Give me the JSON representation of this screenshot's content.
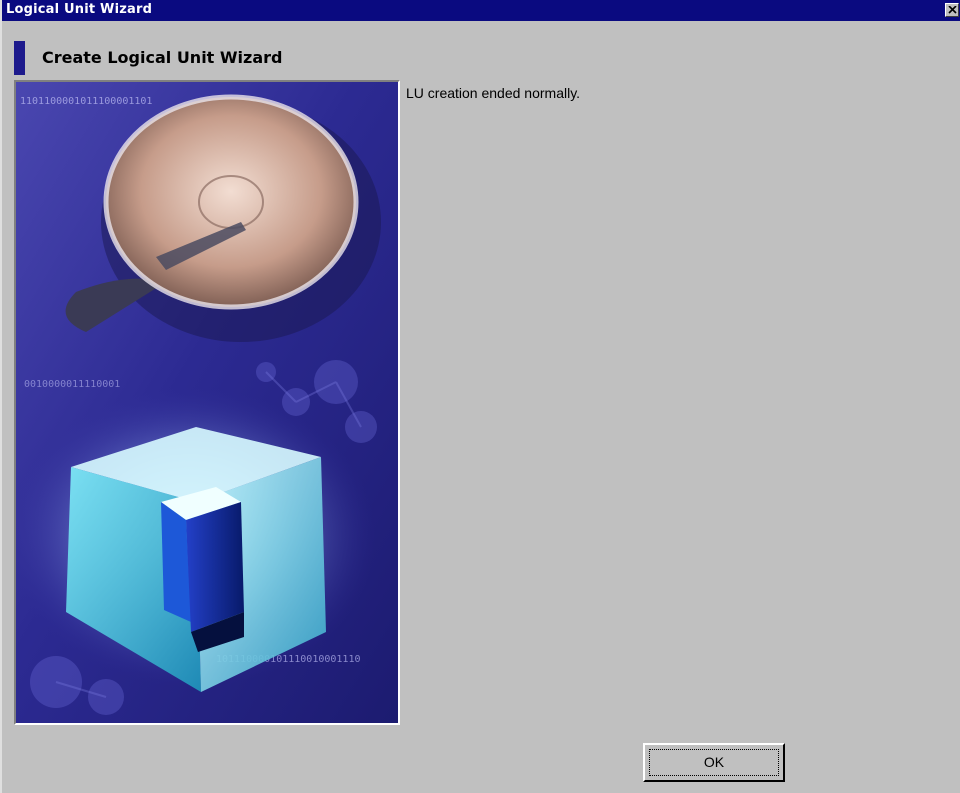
{
  "window": {
    "title": "Logical Unit Wizard",
    "title_bar_color": "#0a0a80",
    "background_color": "#c0c0c0"
  },
  "header": {
    "title": "Create Logical Unit Wizard",
    "marker_color": "#1d1a8c"
  },
  "illustration": {
    "icon": "storage-disk-cube-illustration",
    "binary_text_top": "1101100001011100001101",
    "binary_text_mid": "0010000011110001",
    "binary_text_bottom": "101110000101110010001110"
  },
  "content": {
    "message": "LU creation ended normally."
  },
  "buttons": {
    "ok_label": "OK",
    "close_icon": "close-icon"
  }
}
